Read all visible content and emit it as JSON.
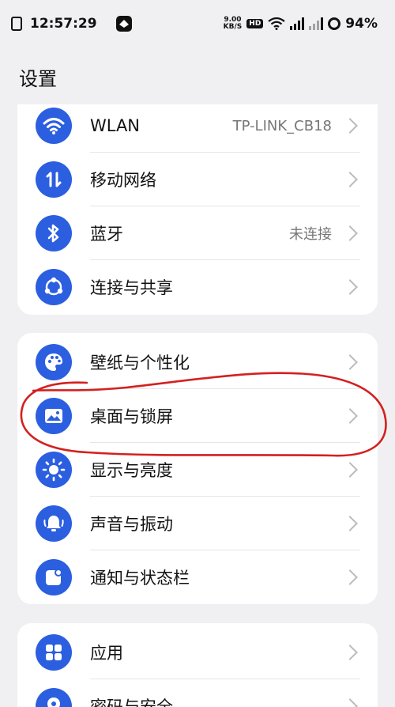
{
  "status_bar": {
    "time": "12:57:29",
    "net_speed_value": "9.00",
    "net_speed_unit": "KB/S",
    "hd": "HD",
    "battery": "94%"
  },
  "header": {
    "title": "设置"
  },
  "groups": [
    {
      "items": [
        {
          "label": "WLAN",
          "value": "TP-LINK_CB18",
          "icon": "wifi-icon"
        },
        {
          "label": "移动网络",
          "value": "",
          "icon": "mobile-data-icon"
        },
        {
          "label": "蓝牙",
          "value": "未连接",
          "icon": "bluetooth-icon"
        },
        {
          "label": "连接与共享",
          "value": "",
          "icon": "share-icon"
        }
      ]
    },
    {
      "items": [
        {
          "label": "壁纸与个性化",
          "value": "",
          "icon": "palette-icon"
        },
        {
          "label": "桌面与锁屏",
          "value": "",
          "icon": "image-icon"
        },
        {
          "label": "显示与亮度",
          "value": "",
          "icon": "brightness-icon"
        },
        {
          "label": "声音与振动",
          "value": "",
          "icon": "bell-icon"
        },
        {
          "label": "通知与状态栏",
          "value": "",
          "icon": "notification-icon"
        }
      ]
    },
    {
      "items": [
        {
          "label": "应用",
          "value": "",
          "icon": "apps-icon"
        },
        {
          "label": "密码与安全",
          "value": "",
          "icon": "location-icon"
        }
      ]
    }
  ],
  "colors": {
    "accent": "#2b5fe0",
    "annotation": "#d42020",
    "background": "#f0f0f2"
  }
}
